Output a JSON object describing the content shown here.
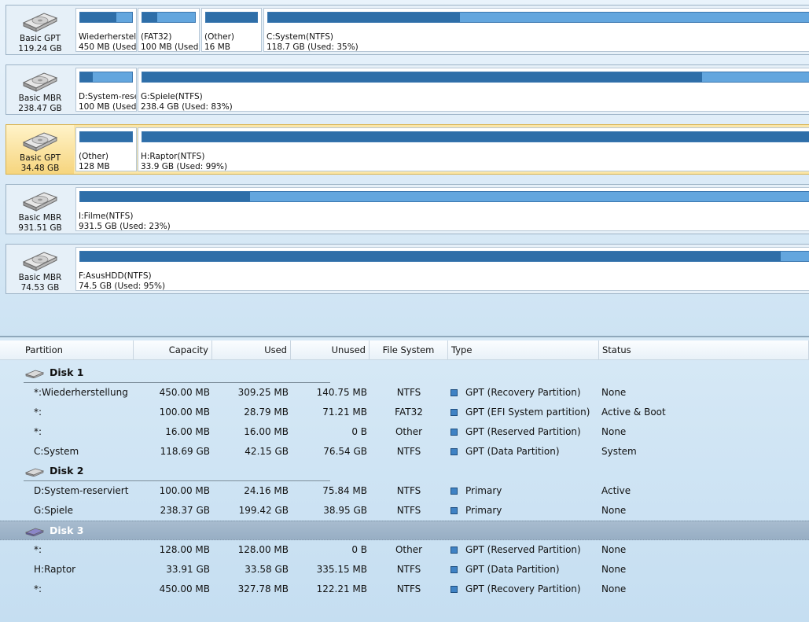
{
  "disks": [
    {
      "type": "Basic GPT",
      "size": "119.24 GB",
      "selected": false,
      "partitions": [
        {
          "name": "Wiederherstell",
          "detail": "450 MB (Used:",
          "used_fraction": 0.69
        },
        {
          "name": "(FAT32)",
          "detail": "100 MB (Used:",
          "used_fraction": 0.29
        },
        {
          "name": "(Other)",
          "detail": "16 MB",
          "used_fraction": 1.0
        },
        {
          "name": "C:System(NTFS)",
          "detail": "118.7 GB (Used: 35%)",
          "used_fraction": 0.35
        }
      ]
    },
    {
      "type": "Basic MBR",
      "size": "238.47 GB",
      "selected": false,
      "partitions": [
        {
          "name": "D:System-rese",
          "detail": "100 MB (Used:",
          "used_fraction": 0.24
        },
        {
          "name": "G:Spiele(NTFS)",
          "detail": "238.4 GB (Used: 83%)",
          "used_fraction": 0.83
        }
      ]
    },
    {
      "type": "Basic GPT",
      "size": "34.48 GB",
      "selected": true,
      "partitions": [
        {
          "name": "(Other)",
          "detail": "128 MB",
          "used_fraction": 1.0
        },
        {
          "name": "H:Raptor(NTFS)",
          "detail": "33.9 GB (Used: 99%)",
          "used_fraction": 0.99
        }
      ]
    },
    {
      "type": "Basic MBR",
      "size": "931.51 GB",
      "selected": false,
      "partitions": [
        {
          "name": "I:Filme(NTFS)",
          "detail": "931.5 GB (Used: 23%)",
          "used_fraction": 0.23
        }
      ]
    },
    {
      "type": "Basic MBR",
      "size": "74.53 GB",
      "selected": false,
      "partitions": [
        {
          "name": "F:AsusHDD(NTFS)",
          "detail": "74.5 GB (Used: 95%)",
          "used_fraction": 0.95
        }
      ]
    }
  ],
  "table": {
    "columns": [
      "Partition",
      "Capacity",
      "Used",
      "Unused",
      "File System",
      "Type",
      "Status"
    ],
    "groups": [
      {
        "label": "Disk 1",
        "selected": false,
        "rows": [
          {
            "partition": "*:Wiederherstellung",
            "capacity": "450.00 MB",
            "used": "309.25 MB",
            "unused": "140.75 MB",
            "fs": "NTFS",
            "type": "GPT (Recovery Partition)",
            "status": "None"
          },
          {
            "partition": "*:",
            "capacity": "100.00 MB",
            "used": "28.79 MB",
            "unused": "71.21 MB",
            "fs": "FAT32",
            "type": "GPT (EFI System partition)",
            "status": "Active & Boot"
          },
          {
            "partition": "*:",
            "capacity": "16.00 MB",
            "used": "16.00 MB",
            "unused": "0 B",
            "fs": "Other",
            "type": "GPT (Reserved Partition)",
            "status": "None"
          },
          {
            "partition": "C:System",
            "capacity": "118.69 GB",
            "used": "42.15 GB",
            "unused": "76.54 GB",
            "fs": "NTFS",
            "type": "GPT (Data Partition)",
            "status": "System"
          }
        ]
      },
      {
        "label": "Disk 2",
        "selected": false,
        "rows": [
          {
            "partition": "D:System-reserviert",
            "capacity": "100.00 MB",
            "used": "24.16 MB",
            "unused": "75.84 MB",
            "fs": "NTFS",
            "type": "Primary",
            "status": "Active"
          },
          {
            "partition": "G:Spiele",
            "capacity": "238.37 GB",
            "used": "199.42 GB",
            "unused": "38.95 GB",
            "fs": "NTFS",
            "type": "Primary",
            "status": "None"
          }
        ]
      },
      {
        "label": "Disk 3",
        "selected": true,
        "rows": [
          {
            "partition": "*:",
            "capacity": "128.00 MB",
            "used": "128.00 MB",
            "unused": "0 B",
            "fs": "Other",
            "type": "GPT (Reserved Partition)",
            "status": "None"
          },
          {
            "partition": "H:Raptor",
            "capacity": "33.91 GB",
            "used": "33.58 GB",
            "unused": "335.15 MB",
            "fs": "NTFS",
            "type": "GPT (Data Partition)",
            "status": "None"
          },
          {
            "partition": "*:",
            "capacity": "450.00 MB",
            "used": "327.78 MB",
            "unused": "122.21 MB",
            "fs": "NTFS",
            "type": "GPT (Recovery Partition)",
            "status": "None"
          }
        ]
      }
    ]
  },
  "colors": {
    "bar_used": "#2e6ea8",
    "bar_free": "#63a6de",
    "selected_disk": "#fbe6a8",
    "selected_group": "#9fb5ca"
  },
  "icons": {
    "disk_map": "hard-disk-icon",
    "group": "hard-disk-small-icon",
    "type_marker": "partition-type-square-icon"
  }
}
